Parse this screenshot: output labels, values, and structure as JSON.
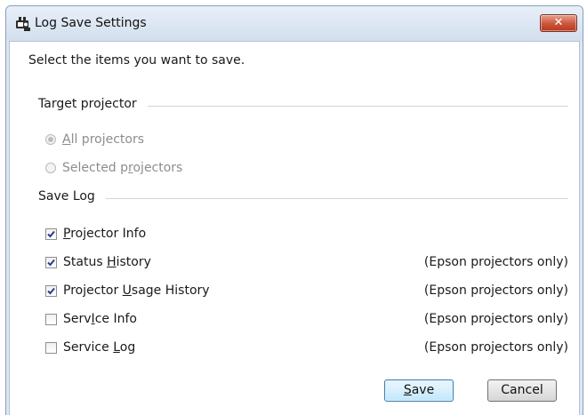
{
  "window": {
    "title": "Log Save Settings",
    "close_glyph": "✕",
    "title_icon": "projector-log-icon"
  },
  "instruction": "Select the items you want to save.",
  "target_group": {
    "label": "Target projector",
    "options": [
      {
        "label": "All projectors",
        "selected": true,
        "enabled": false
      },
      {
        "label": "Selected projectors",
        "selected": false,
        "enabled": false
      }
    ]
  },
  "save_log_group": {
    "label": "Save Log",
    "items": [
      {
        "label": "Projector Info",
        "checked": true,
        "note": ""
      },
      {
        "label": "Status History",
        "checked": true,
        "note": "(Epson projectors only)"
      },
      {
        "label": "Projector Usage History",
        "checked": true,
        "note": "(Epson projectors only)"
      },
      {
        "label": "ServIce Info",
        "checked": false,
        "note": "(Epson projectors only)"
      },
      {
        "label": "Service Log",
        "checked": false,
        "note": "(Epson projectors only)"
      }
    ]
  },
  "buttons": {
    "save": "Save",
    "cancel": "Cancel"
  },
  "colors": {
    "titlebar": "#d3dfee",
    "close_button": "#c9553a",
    "default_button_border": "#3c7fb1",
    "disabled_text": "#8d8d8d"
  }
}
